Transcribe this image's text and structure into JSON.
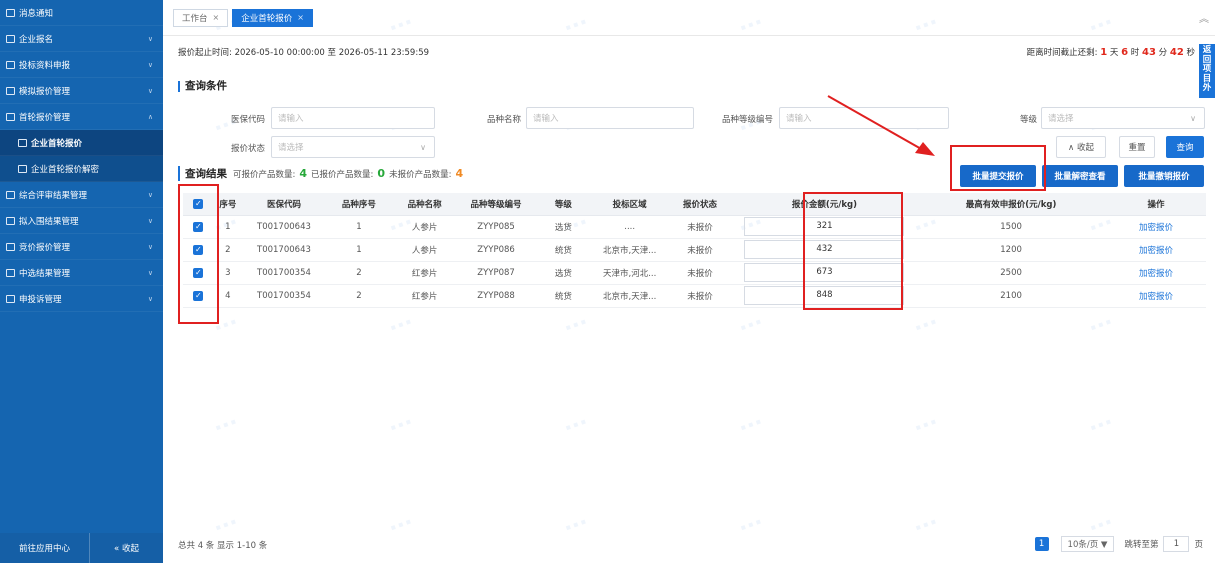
{
  "sidebar": {
    "items": [
      {
        "label": "消息通知",
        "type": "top"
      },
      {
        "label": "企业报名",
        "type": "top"
      },
      {
        "label": "投标资料申报",
        "type": "top"
      },
      {
        "label": "模拟报价管理",
        "type": "top"
      },
      {
        "label": "首轮报价管理",
        "type": "top"
      },
      {
        "label": "企业首轮报价",
        "type": "sub-active"
      },
      {
        "label": "企业首轮报价解密",
        "type": "sub"
      },
      {
        "label": "综合评审结果管理",
        "type": "top"
      },
      {
        "label": "拟入围结果管理",
        "type": "top"
      },
      {
        "label": "竞价报价管理",
        "type": "top"
      },
      {
        "label": "中选结果管理",
        "type": "top"
      },
      {
        "label": "申投诉管理",
        "type": "top"
      }
    ],
    "bottom_left": "前往应用中心",
    "bottom_right": "« 收起"
  },
  "tabs": [
    {
      "label": "工作台"
    },
    {
      "label": "企业首轮报价"
    }
  ],
  "timeline": "报价起止时间: 2026-05-10 00:00:00 至 2026-05-11 23:59:59",
  "deadline": {
    "prefix": "距离时间截止还剩:",
    "days": "1",
    "d_unit": "天",
    "hours": "6",
    "h_unit": "时",
    "minutes": "43",
    "m_unit": "分",
    "seconds": "42",
    "s_unit": "秒"
  },
  "side_tab": "返回项目外",
  "query": {
    "title": "查询条件",
    "fields": {
      "medical_code": {
        "label": "医保代码",
        "placeholder": "请输入"
      },
      "variety_name": {
        "label": "品种名称",
        "placeholder": "请输入"
      },
      "variety_grade_code": {
        "label": "品种等级编号",
        "placeholder": "请输入"
      },
      "grade": {
        "label": "等级",
        "placeholder": "请选择"
      },
      "quote_status": {
        "label": "报价状态",
        "placeholder": "请选择"
      }
    },
    "collapse": "∧ 收起",
    "reset": "重置",
    "search": "查询"
  },
  "results": {
    "title": "查询结果",
    "quotable_label": "可报价产品数量:",
    "quotable": "4",
    "quoted_label": "已报价产品数量:",
    "quoted": "0",
    "unquoted_label": "未报价产品数量:",
    "unquoted": "4",
    "batch_submit": "批量提交报价",
    "batch_decrypt": "批量解密查看",
    "batch_revoke": "批量撤销报价"
  },
  "table": {
    "headers": [
      "序号",
      "医保代码",
      "品种序号",
      "品种名称",
      "品种等级编号",
      "等级",
      "投标区域",
      "报价状态",
      "报价金额(元/kg)",
      "最高有效申报价(元/kg)",
      "操作"
    ],
    "rows": [
      [
        "1",
        "T001700643",
        "1",
        "人参片",
        "ZYYP085",
        "选货",
        "....",
        "未报价",
        "321",
        "1500",
        "加密报价"
      ],
      [
        "2",
        "T001700643",
        "1",
        "人参片",
        "ZYYP086",
        "统货",
        "北京市,天津...",
        "未报价",
        "432",
        "1200",
        "加密报价"
      ],
      [
        "3",
        "T001700354",
        "2",
        "红参片",
        "ZYYP087",
        "选货",
        "天津市,河北...",
        "未报价",
        "673",
        "2500",
        "加密报价"
      ],
      [
        "4",
        "T001700354",
        "2",
        "红参片",
        "ZYYP088",
        "统货",
        "北京市,天津...",
        "未报价",
        "848",
        "2100",
        "加密报价"
      ]
    ]
  },
  "footer": {
    "summary": "总共 4 条 显示 1-10 条",
    "page": "1",
    "page_size": "10条/页 ▼",
    "jump_prefix": "跳转至第",
    "jump_value": "1",
    "jump_suffix": "页"
  },
  "colors": {
    "sidebar": "#1565b0",
    "accent": "#1a73d8",
    "highlight": "#e02020",
    "green": "#27a83a",
    "orange": "#f08a24"
  }
}
